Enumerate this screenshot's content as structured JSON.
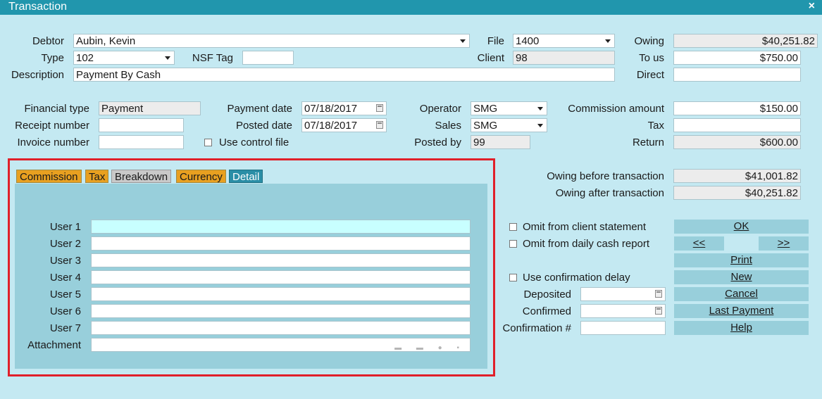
{
  "window": {
    "title": "Transaction",
    "close_glyph": "×"
  },
  "header": {
    "debtor_label": "Debtor",
    "debtor_value": "Aubin, Kevin",
    "type_label": "Type",
    "type_value": "102",
    "nsf_label": "NSF Tag",
    "nsf_value": "",
    "description_label": "Description",
    "description_value": "Payment By Cash",
    "file_label": "File",
    "file_value": "1400",
    "client_label": "Client",
    "client_value": "98",
    "owing_label": "Owing",
    "owing_value": "$40,251.82",
    "tous_label": "To us",
    "tous_value": "$750.00",
    "direct_label": "Direct",
    "direct_value": ""
  },
  "details": {
    "financial_type_label": "Financial type",
    "financial_type_value": "Payment",
    "receipt_label": "Receipt number",
    "receipt_value": "",
    "invoice_label": "Invoice number",
    "invoice_value": "",
    "payment_date_label": "Payment date",
    "payment_date_value": "07/18/2017",
    "posted_date_label": "Posted date",
    "posted_date_value": "07/18/2017",
    "use_control_label": "Use control file",
    "operator_label": "Operator",
    "operator_value": "SMG",
    "sales_label": "Sales",
    "sales_value": "SMG",
    "posted_by_label": "Posted by",
    "posted_by_value": "99",
    "commission_label": "Commission amount",
    "commission_value": "$150.00",
    "tax_label": "Tax",
    "tax_value": "",
    "return_label": "Return",
    "return_value": "$600.00"
  },
  "tabs": [
    {
      "label": "Commission",
      "color": "#e8a020"
    },
    {
      "label": "Tax",
      "color": "#e8a020"
    },
    {
      "label": "Breakdown",
      "color": "#c9c9c9"
    },
    {
      "label": "Currency",
      "color": "#e8a020"
    },
    {
      "label": "Detail",
      "color": "#2a8ea6"
    }
  ],
  "detail_tab": {
    "users": [
      {
        "label": "User 1",
        "value": ""
      },
      {
        "label": "User 2",
        "value": ""
      },
      {
        "label": "User 3",
        "value": ""
      },
      {
        "label": "User 4",
        "value": ""
      },
      {
        "label": "User 5",
        "value": ""
      },
      {
        "label": "User 6",
        "value": ""
      },
      {
        "label": "User 7",
        "value": ""
      }
    ],
    "attachment_label": "Attachment",
    "attachment_icons": "▬ ▬ ● ▪"
  },
  "summary": {
    "owing_before_label": "Owing before transaction",
    "owing_before_value": "$41,001.82",
    "owing_after_label": "Owing after transaction",
    "owing_after_value": "$40,251.82"
  },
  "options": {
    "omit_client_label": "Omit from client statement",
    "omit_daily_label": "Omit from daily cash report",
    "use_conf_delay_label": "Use confirmation delay",
    "deposited_label": "Deposited",
    "deposited_value": "",
    "confirmed_label": "Confirmed",
    "confirmed_value": "",
    "confirmation_no_label": "Confirmation #",
    "confirmation_no_value": ""
  },
  "buttons": {
    "ok": "OK",
    "prev": "<<",
    "next": ">>",
    "print": "Print",
    "new": "New",
    "cancel": "Cancel",
    "last_payment": "Last Payment",
    "help": "Help"
  }
}
